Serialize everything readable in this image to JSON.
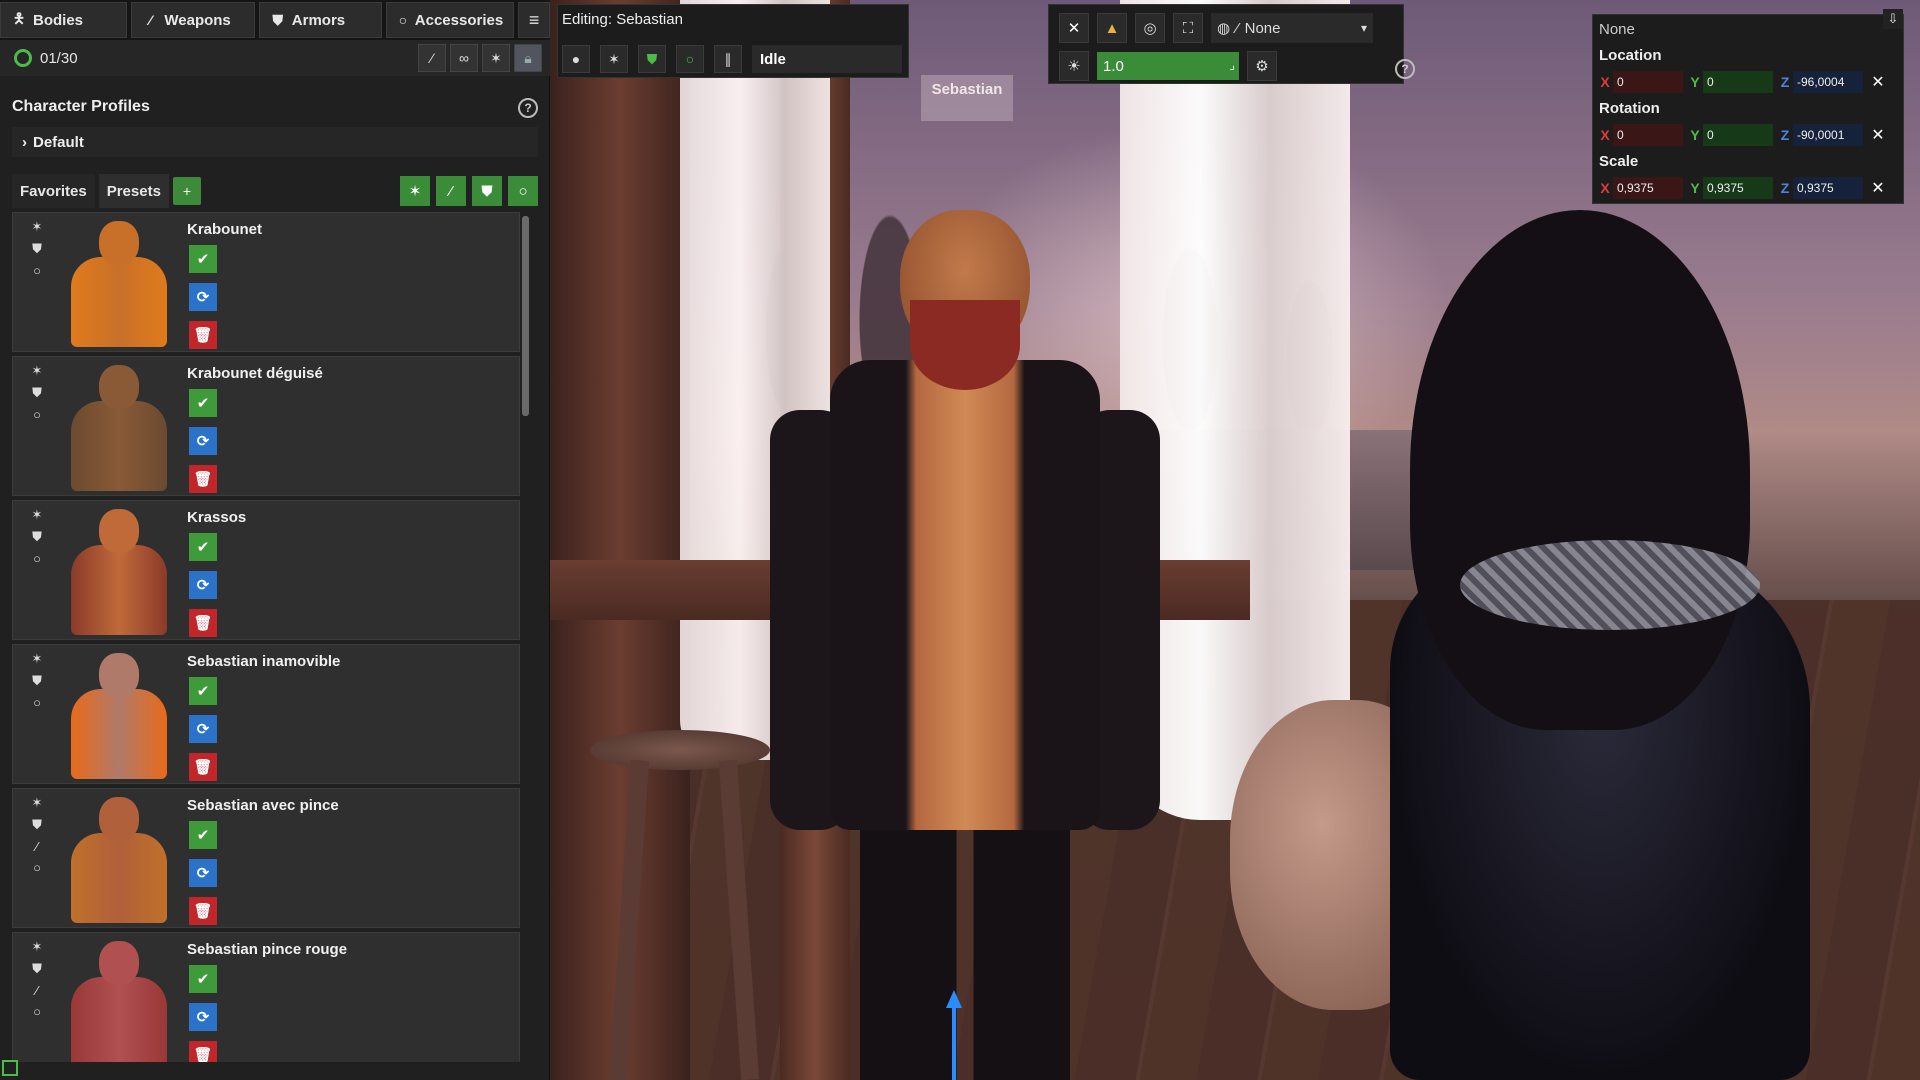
{
  "top_tabs": [
    {
      "label": "Bodies",
      "icon": "figure-icon"
    },
    {
      "label": "Weapons",
      "icon": "sword-icon"
    },
    {
      "label": "Armors",
      "icon": "shield-icon"
    },
    {
      "label": "Accessories",
      "icon": "ring-icon"
    }
  ],
  "counter": {
    "value": "01/30"
  },
  "profiles": {
    "title": "Character Profiles",
    "selected": "Default"
  },
  "subtabs": {
    "favorites": "Favorites",
    "presets": "Presets"
  },
  "presets": [
    {
      "name": "Krabounet",
      "skin": "#c8702a",
      "outfit": "#e07a1c",
      "icons": [
        "figure-icon",
        "shield-icon",
        "ring-icon"
      ]
    },
    {
      "name": "Krabounet déguisé",
      "skin": "#8a5a36",
      "outfit": "#6b4a30",
      "icons": [
        "figure-icon",
        "shield-icon",
        "ring-icon"
      ]
    },
    {
      "name": "Krassos",
      "skin": "#c06a3a",
      "outfit": "#8a3a2a",
      "icons": [
        "figure-icon",
        "shield-icon",
        "ring-icon"
      ]
    },
    {
      "name": "Sebastian inamovible",
      "skin": "#b07a6a",
      "outfit": "#e86a1a",
      "icons": [
        "figure-icon",
        "shield-icon",
        "ring-icon"
      ]
    },
    {
      "name": "Sebastian avec pince",
      "skin": "#b0603a",
      "outfit": "#c0702a",
      "icons": [
        "figure-icon",
        "shield-icon",
        "sword-icon",
        "ring-icon"
      ]
    },
    {
      "name": "Sebastian pince rouge",
      "skin": "#b05050",
      "outfit": "#9a3838",
      "icons": [
        "figure-icon",
        "shield-icon",
        "sword-icon",
        "ring-icon"
      ]
    }
  ],
  "editor": {
    "title": "Editing: Sebastian",
    "animation": "Idle"
  },
  "toolbar": {
    "target_select": "None",
    "speed_value": "1.0"
  },
  "scene": {
    "nameplate": "Sebastian"
  },
  "transform": {
    "bone": "None",
    "location_label": "Location",
    "location": {
      "x": "0",
      "y": "0",
      "z": "-96,0004"
    },
    "rotation_label": "Rotation",
    "rotation": {
      "x": "0",
      "y": "0",
      "z": "-90,0001"
    },
    "scale_label": "Scale",
    "scale": {
      "x": "0,9375",
      "y": "0,9375",
      "z": "0,9375"
    }
  },
  "colors": {
    "accent_green": "#3f9a3c",
    "refresh_blue": "#2a73c8",
    "delete_red": "#c0262a"
  }
}
